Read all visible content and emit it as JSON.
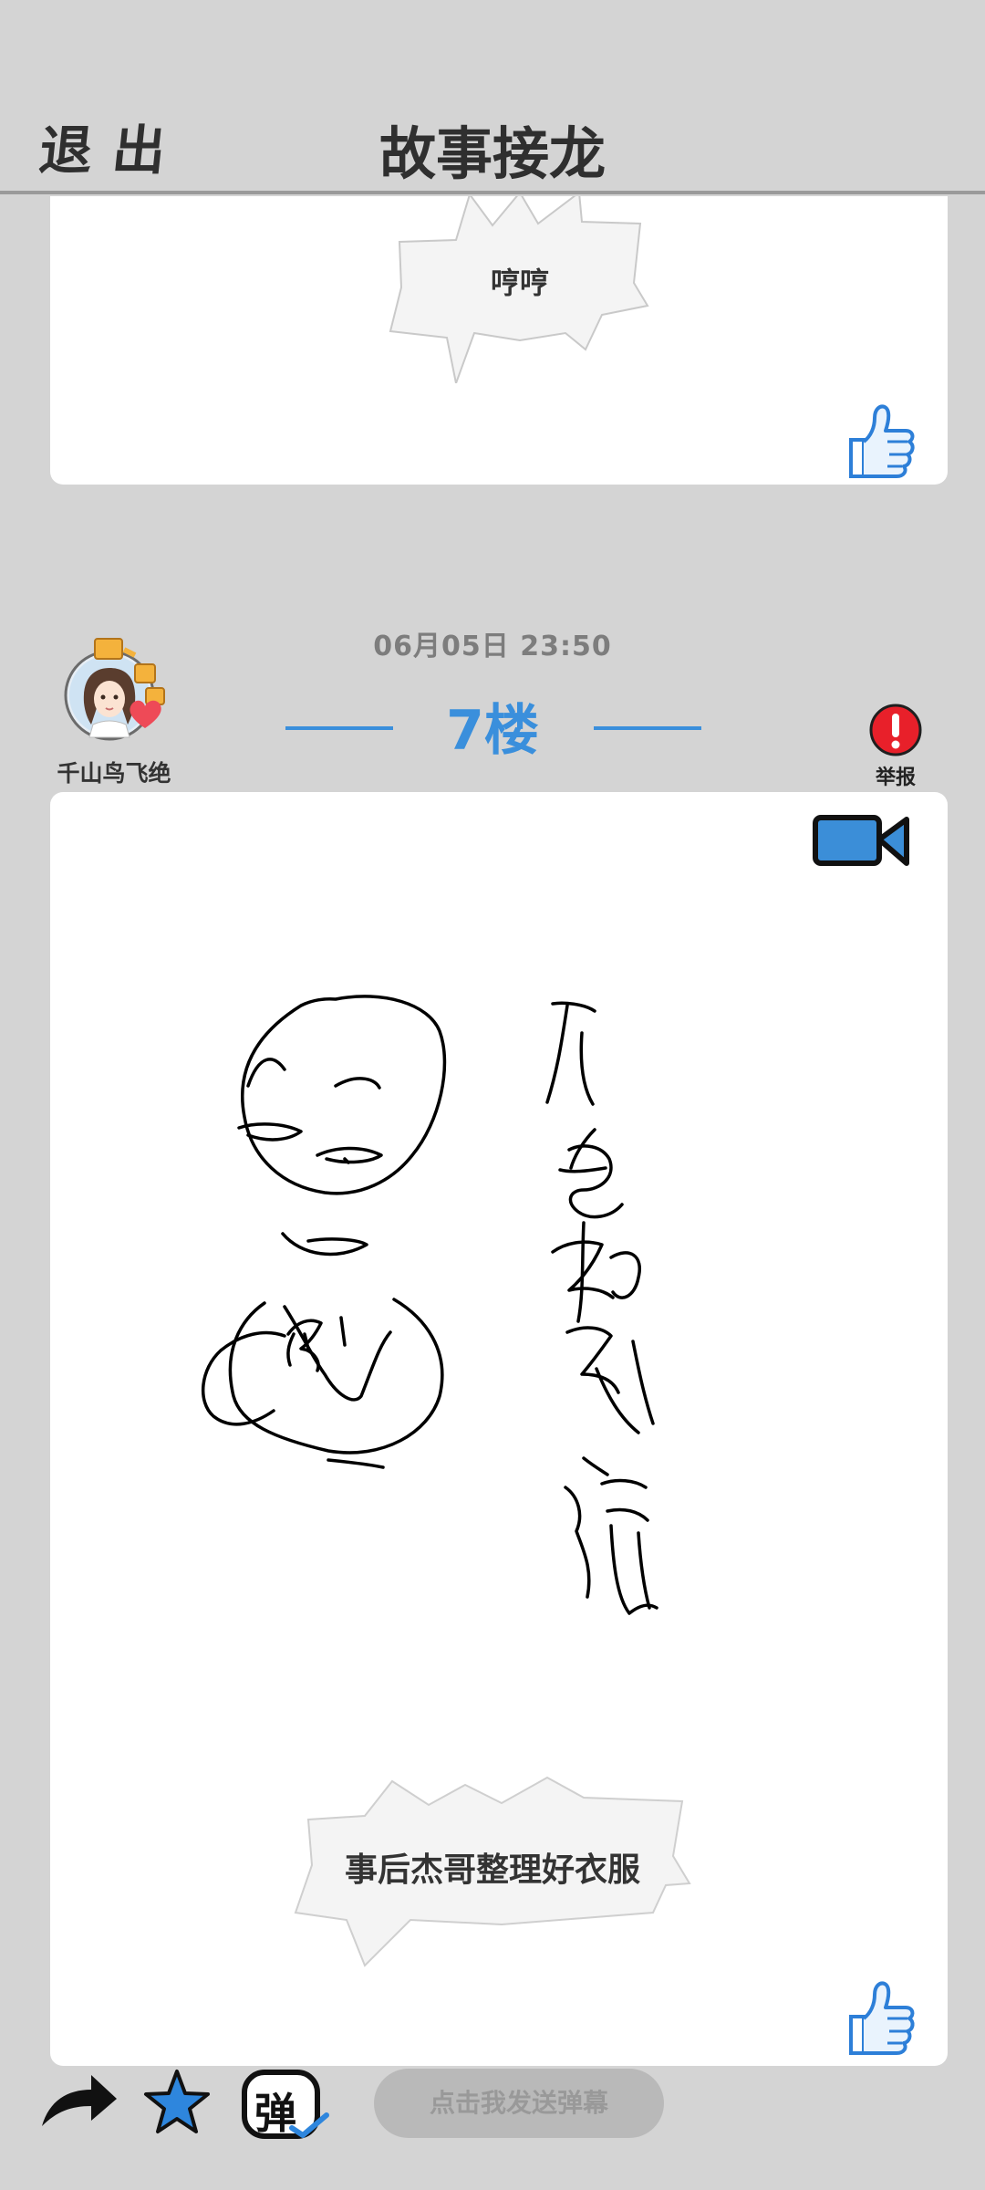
{
  "header": {
    "exit_label": "退出",
    "title": "故事接龙"
  },
  "previous_post": {
    "caption": "哼哼",
    "like_icon": "thumbs-up-icon"
  },
  "post": {
    "date": "06月05日  23:50",
    "floor": "7楼",
    "user": {
      "name": "千山鸟飞绝",
      "avatar_icon": "avatar-girl-with-heart"
    },
    "report_label": "举报",
    "media_icon": "video-camera-icon",
    "drawing_text": "不要和动人说",
    "caption": "事后杰哥整理好衣服",
    "like_icon": "thumbs-up-icon"
  },
  "bottom_bar": {
    "share_icon": "share-arrow-icon",
    "favorite_icon": "star-icon",
    "danmaku_toggle_label": "弹",
    "danmaku_placeholder": "点击我发送弹幕"
  },
  "colors": {
    "accent": "#3a8fdc",
    "background": "#d4d4d4",
    "report": "#e8202a"
  }
}
